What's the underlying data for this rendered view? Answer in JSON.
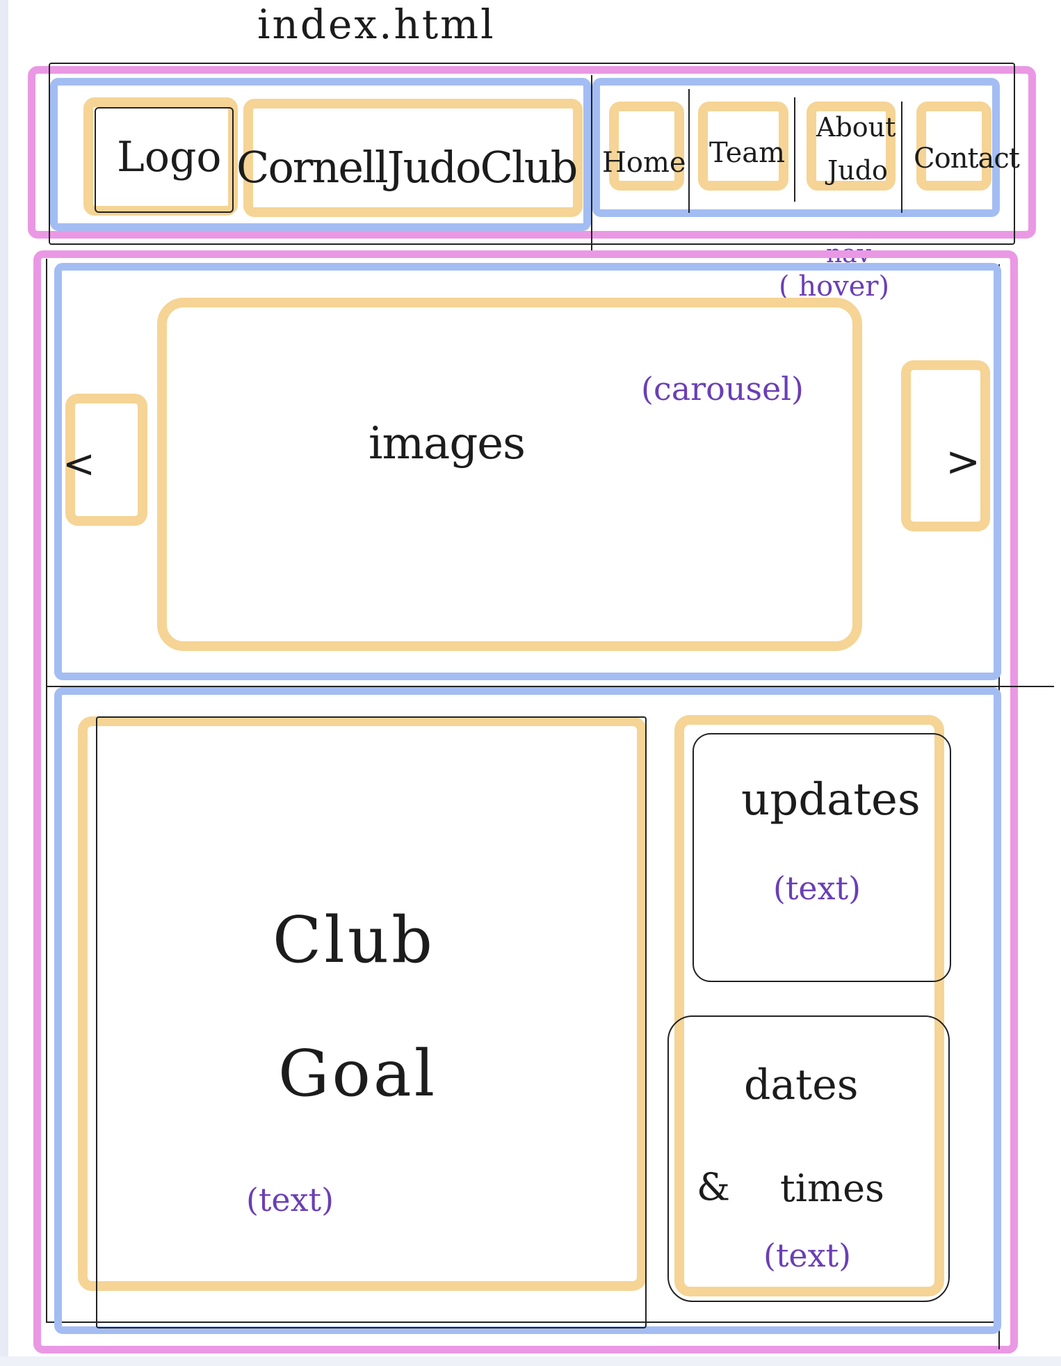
{
  "page_title": "index.html",
  "header": {
    "logo": "Logo",
    "brand": "CornellJudoClub",
    "nav": {
      "items": [
        {
          "label": "Home"
        },
        {
          "label": "Team"
        },
        {
          "label_line1": "About",
          "label_line2": "Judo"
        },
        {
          "label": "Contact"
        }
      ],
      "note_line1": "nav",
      "note_line2": "( hover)"
    }
  },
  "carousel": {
    "note": "(carousel)",
    "content": "images",
    "prev": "<",
    "next": ">"
  },
  "club_goal": {
    "line1": "Club",
    "line2": "Goal",
    "note": "(text)"
  },
  "updates": {
    "title": "updates",
    "note": "(text)"
  },
  "dates": {
    "line1": "dates",
    "amp": "&",
    "line2": "times",
    "note": "(text)"
  },
  "colors": {
    "page": "#ea98e4",
    "section": "#a3bdf3",
    "element": "#f5d495",
    "annotation": "#6a3fb5"
  }
}
